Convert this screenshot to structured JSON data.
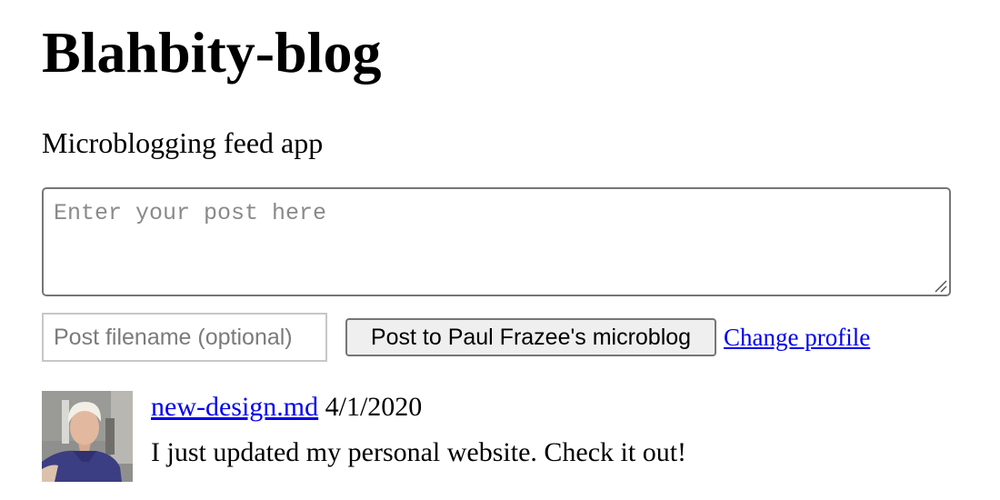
{
  "header": {
    "title": "Blahbity-blog",
    "subtitle": "Microblogging feed app"
  },
  "composer": {
    "post_placeholder": "Enter your post here",
    "post_value": "",
    "filename_placeholder": "Post filename (optional)",
    "filename_value": "",
    "submit_label": "Post to Paul Frazee's microblog",
    "change_profile_label": "Change profile"
  },
  "feed": {
    "posts": [
      {
        "filename": "new-design.md",
        "date": "4/1/2020",
        "text": "I just updated my personal website. Check it out!",
        "avatar_icon": "user-avatar-photo"
      }
    ]
  },
  "colors": {
    "link": "#0000ee",
    "button_background": "#efefef",
    "border": "#767676"
  }
}
